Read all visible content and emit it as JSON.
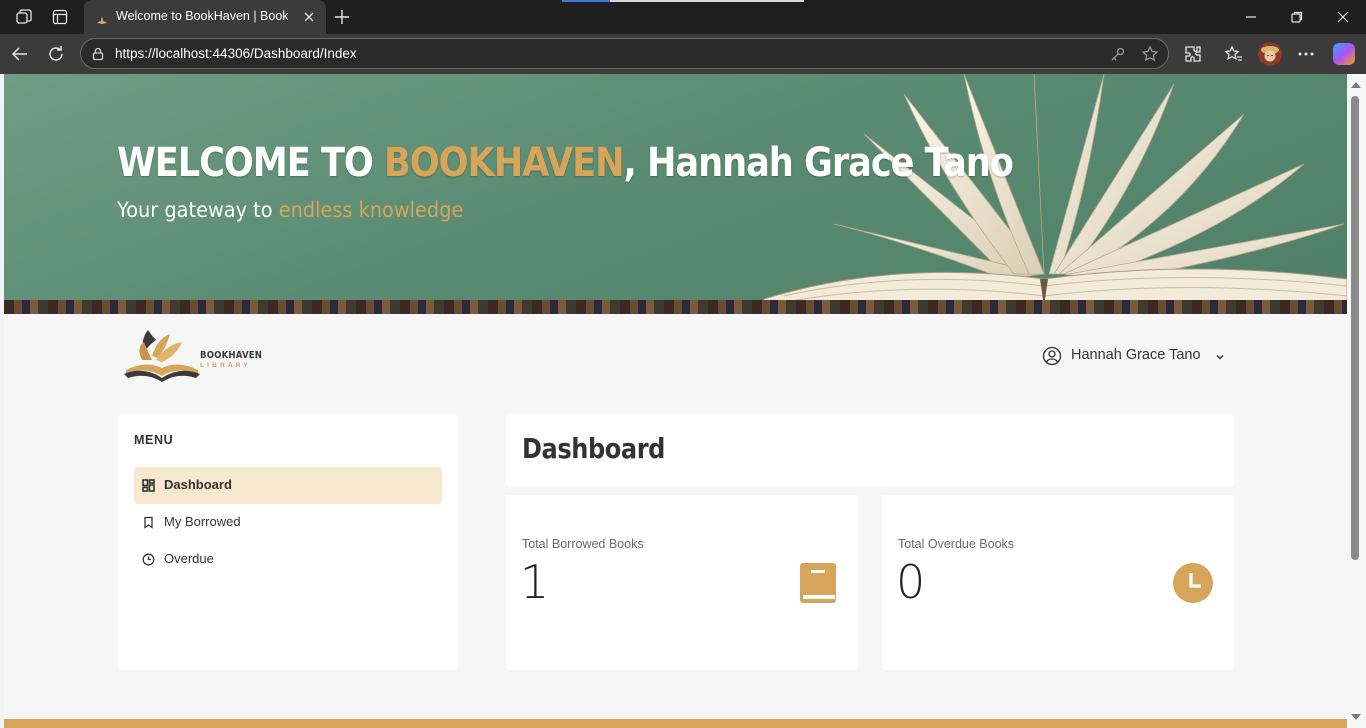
{
  "browser": {
    "tab_title": "Welcome to BookHaven | BookHa",
    "url": "https://localhost:44306/Dashboard/Index"
  },
  "hero": {
    "title_prefix": "WELCOME TO ",
    "title_brand": "BOOKHAVEN",
    "title_suffix": ", Hannah Grace Tano",
    "subtitle_prefix": "Your gateway to ",
    "subtitle_accent": "endless knowledge"
  },
  "logo": {
    "name": "BOOKHAVEN",
    "sub": "LIBRARY"
  },
  "user": {
    "name": "Hannah Grace Tano"
  },
  "sidebar": {
    "title": "MENU",
    "items": [
      {
        "label": "Dashboard",
        "icon": "dashboard-icon",
        "active": true
      },
      {
        "label": "My Borrowed",
        "icon": "bookmark-icon",
        "active": false
      },
      {
        "label": "Overdue",
        "icon": "clock-icon",
        "active": false
      }
    ]
  },
  "main": {
    "title": "Dashboard",
    "stats": [
      {
        "label": "Total Borrowed Books",
        "value": "1",
        "icon": "book-icon"
      },
      {
        "label": "Total Overdue Books",
        "value": "0",
        "icon": "clock-icon"
      }
    ]
  },
  "colors": {
    "accent": "#d6a55a",
    "active_bg": "#f7e9cf",
    "hero_green": "#5b8c73"
  }
}
